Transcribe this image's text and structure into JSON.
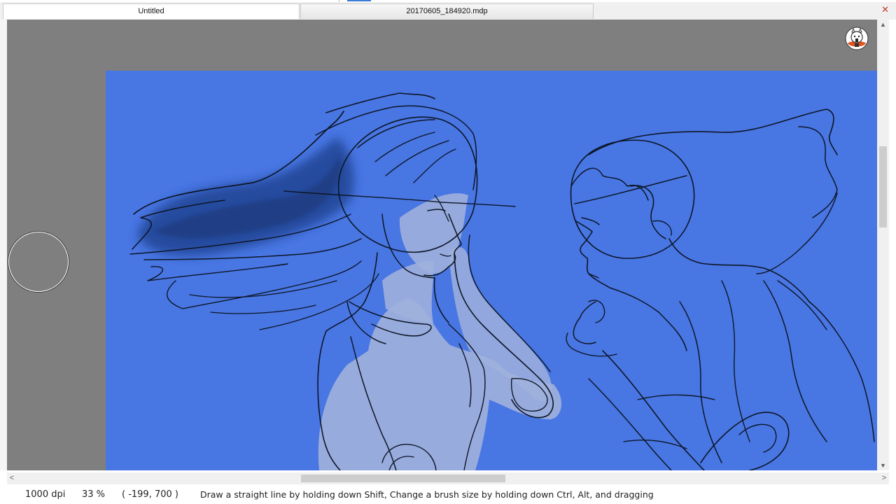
{
  "tabs": [
    {
      "label": "Untitled",
      "active": true
    },
    {
      "label": "20170605_184920.mdp",
      "active": false
    }
  ],
  "window": {
    "close_glyph": "✕"
  },
  "canvas": {
    "background_color": "#4876e3",
    "workspace_color": "#7f7f7f",
    "line_color": "#0d1626",
    "shade_color": "#9fb0dc",
    "hair_shadow_color": "#1e3f8c"
  },
  "mascot": {
    "icon": "alpaca-mascot-icon"
  },
  "scrollbars": {
    "up_glyph": "▲",
    "down_glyph": "▼",
    "left_glyph": "<",
    "right_glyph": ">"
  },
  "status": {
    "dpi": "1000 dpi",
    "zoom": "33 %",
    "coords": "( -199, 700 )",
    "hint": "Draw a straight line by holding down Shift, Change a brush size by holding down Ctrl, Alt, and dragging"
  }
}
